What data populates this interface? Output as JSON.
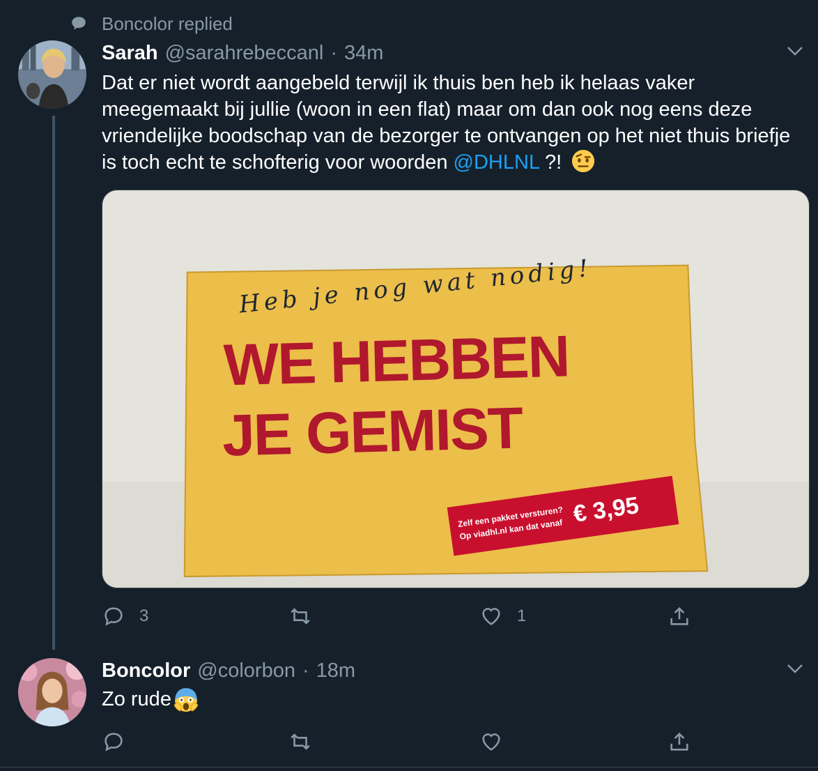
{
  "context": {
    "text": "Boncolor replied",
    "icon": "speech-bubble-icon"
  },
  "tweets": [
    {
      "name": "Sarah",
      "handle": "@sarahrebeccanl",
      "separator": "·",
      "time": "34m",
      "text_before": "Dat er niet wordt aangebeld terwijl ik thuis ben heb ik helaas vaker meegemaakt bij jullie (woon in een flat) maar om dan ook nog eens deze vriendelijke boodschap van de bezorger te ontvangen op het niet thuis briefje is toch echt te schofterig voor woorden ",
      "mention": "@DHLNL",
      "text_after": " ?!",
      "emoji": "face-with-raised-eyebrow",
      "media": {
        "handwriting": "Heb je nog wat nodig!",
        "headline_line1": "WE HEBBEN",
        "headline_line2": "JE GEMIST",
        "label_line1": "Zelf een pakket versturen?",
        "label_line2": "Op viadhl.nl kan dat vanaf",
        "price": "€ 3,95"
      },
      "actions": {
        "replies": "3",
        "retweets": "",
        "likes": "1"
      }
    },
    {
      "name": "Boncolor",
      "handle": "@colorbon",
      "separator": "·",
      "time": "18m",
      "text": "Zo rude",
      "emoji": "face-screaming-in-fear",
      "actions": {
        "replies": "",
        "retweets": "",
        "likes": ""
      }
    }
  ],
  "colors": {
    "background": "#15202b",
    "secondary": "#8899a6",
    "link": "#1da1f2",
    "dhl_red": "#c8102e",
    "dhl_yellow": "#f5c540"
  }
}
